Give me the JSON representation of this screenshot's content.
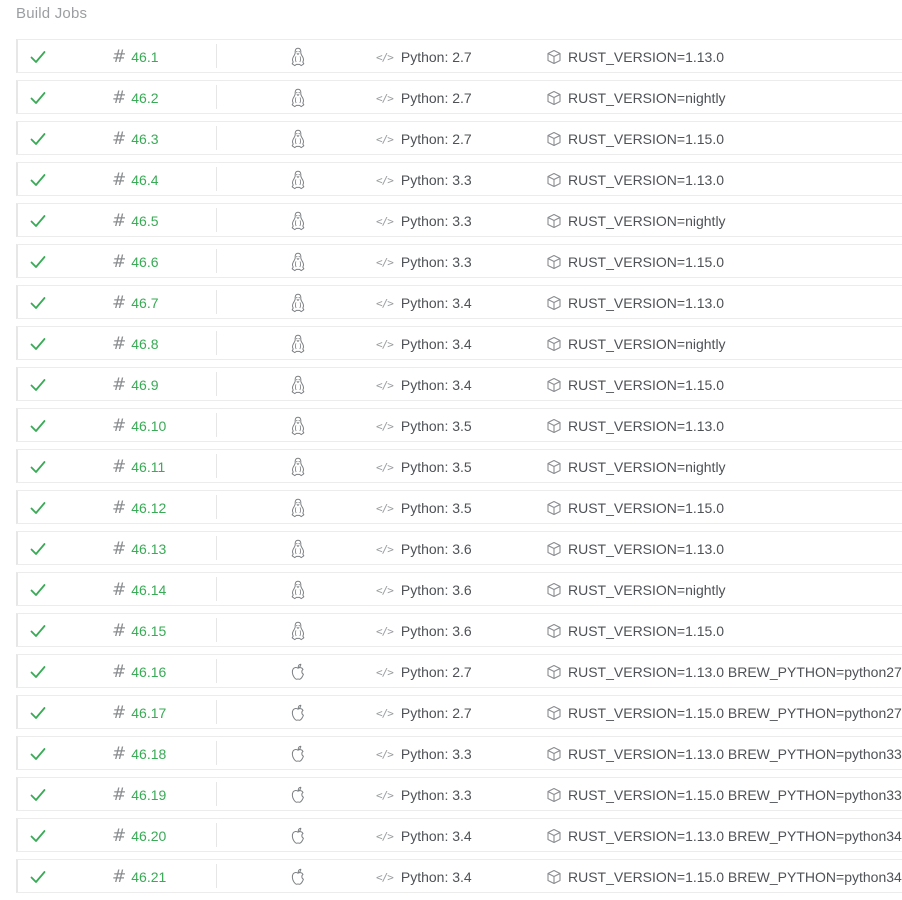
{
  "section": {
    "title": "Build Jobs"
  },
  "colors": {
    "passed": "#39aa56",
    "text": "#4e5256",
    "muted": "#9b9ea1",
    "border": "#ececec"
  },
  "jobs": [
    {
      "status": "passed",
      "number": "46.1",
      "os": "linux",
      "language": "Python: 2.7",
      "env": "RUST_VERSION=1.13.0"
    },
    {
      "status": "passed",
      "number": "46.2",
      "os": "linux",
      "language": "Python: 2.7",
      "env": "RUST_VERSION=nightly"
    },
    {
      "status": "passed",
      "number": "46.3",
      "os": "linux",
      "language": "Python: 2.7",
      "env": "RUST_VERSION=1.15.0"
    },
    {
      "status": "passed",
      "number": "46.4",
      "os": "linux",
      "language": "Python: 3.3",
      "env": "RUST_VERSION=1.13.0"
    },
    {
      "status": "passed",
      "number": "46.5",
      "os": "linux",
      "language": "Python: 3.3",
      "env": "RUST_VERSION=nightly"
    },
    {
      "status": "passed",
      "number": "46.6",
      "os": "linux",
      "language": "Python: 3.3",
      "env": "RUST_VERSION=1.15.0"
    },
    {
      "status": "passed",
      "number": "46.7",
      "os": "linux",
      "language": "Python: 3.4",
      "env": "RUST_VERSION=1.13.0"
    },
    {
      "status": "passed",
      "number": "46.8",
      "os": "linux",
      "language": "Python: 3.4",
      "env": "RUST_VERSION=nightly"
    },
    {
      "status": "passed",
      "number": "46.9",
      "os": "linux",
      "language": "Python: 3.4",
      "env": "RUST_VERSION=1.15.0"
    },
    {
      "status": "passed",
      "number": "46.10",
      "os": "linux",
      "language": "Python: 3.5",
      "env": "RUST_VERSION=1.13.0"
    },
    {
      "status": "passed",
      "number": "46.11",
      "os": "linux",
      "language": "Python: 3.5",
      "env": "RUST_VERSION=nightly"
    },
    {
      "status": "passed",
      "number": "46.12",
      "os": "linux",
      "language": "Python: 3.5",
      "env": "RUST_VERSION=1.15.0"
    },
    {
      "status": "passed",
      "number": "46.13",
      "os": "linux",
      "language": "Python: 3.6",
      "env": "RUST_VERSION=1.13.0"
    },
    {
      "status": "passed",
      "number": "46.14",
      "os": "linux",
      "language": "Python: 3.6",
      "env": "RUST_VERSION=nightly"
    },
    {
      "status": "passed",
      "number": "46.15",
      "os": "linux",
      "language": "Python: 3.6",
      "env": "RUST_VERSION=1.15.0"
    },
    {
      "status": "passed",
      "number": "46.16",
      "os": "osx",
      "language": "Python: 2.7",
      "env": "RUST_VERSION=1.13.0 BREW_PYTHON=python27"
    },
    {
      "status": "passed",
      "number": "46.17",
      "os": "osx",
      "language": "Python: 2.7",
      "env": "RUST_VERSION=1.15.0 BREW_PYTHON=python27"
    },
    {
      "status": "passed",
      "number": "46.18",
      "os": "osx",
      "language": "Python: 3.3",
      "env": "RUST_VERSION=1.13.0 BREW_PYTHON=python33"
    },
    {
      "status": "passed",
      "number": "46.19",
      "os": "osx",
      "language": "Python: 3.3",
      "env": "RUST_VERSION=1.15.0 BREW_PYTHON=python33"
    },
    {
      "status": "passed",
      "number": "46.20",
      "os": "osx",
      "language": "Python: 3.4",
      "env": "RUST_VERSION=1.13.0 BREW_PYTHON=python34"
    },
    {
      "status": "passed",
      "number": "46.21",
      "os": "osx",
      "language": "Python: 3.4",
      "env": "RUST_VERSION=1.15.0 BREW_PYTHON=python34"
    }
  ]
}
